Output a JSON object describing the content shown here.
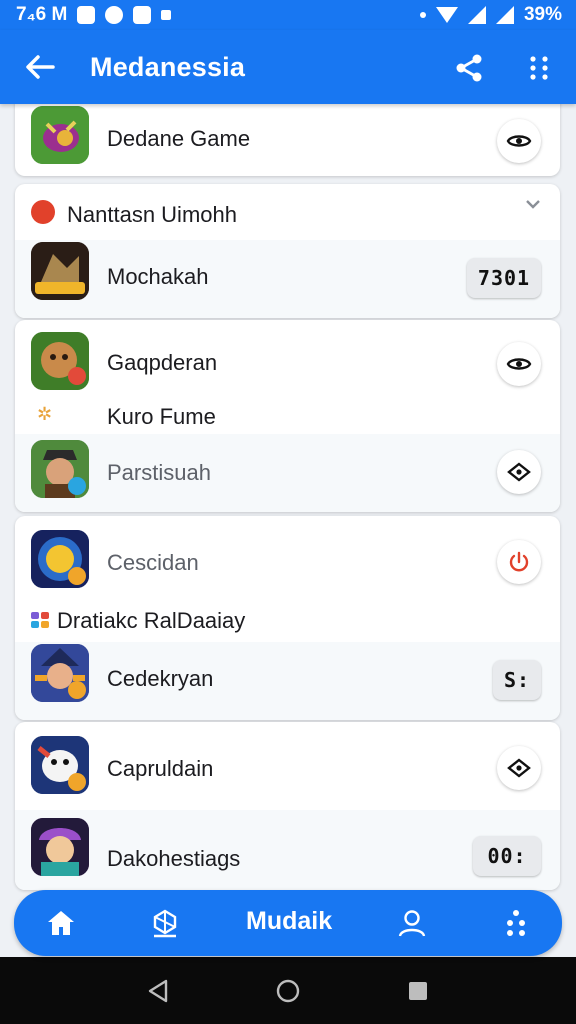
{
  "status_bar": {
    "time": "7₄6 M",
    "battery": "39%"
  },
  "app_bar": {
    "title": "Medanessia"
  },
  "cards": [
    {
      "rows": [
        {
          "name": "Dedane Game",
          "action_icon": "eye-icon"
        }
      ]
    },
    {
      "section_title": "Nanttasn Uimohh",
      "rows": [
        {
          "name": "Mochakah",
          "action_label": "7301"
        }
      ]
    },
    {
      "rows": [
        {
          "name": "Gaqpderan",
          "action_icon": "eye-icon"
        },
        {
          "name": "Kuro Fume"
        },
        {
          "name": "Parstisuah",
          "action_icon": "diamond-icon"
        }
      ]
    },
    {
      "rows": [
        {
          "name": "Cescidan",
          "action_icon": "power-icon"
        },
        {
          "name": "Dratiakc RalDaaiay"
        },
        {
          "name": "Cedekryan",
          "action_label": "S:"
        }
      ]
    },
    {
      "rows": [
        {
          "name": "Capruldain",
          "action_icon": "diamond-icon"
        },
        {
          "name": "Dakohestiags",
          "action_label": "00:"
        }
      ]
    }
  ],
  "bottom_nav": {
    "label": "Mudaik"
  },
  "colors": {
    "primary": "#1877f2",
    "danger": "#e1412b"
  }
}
